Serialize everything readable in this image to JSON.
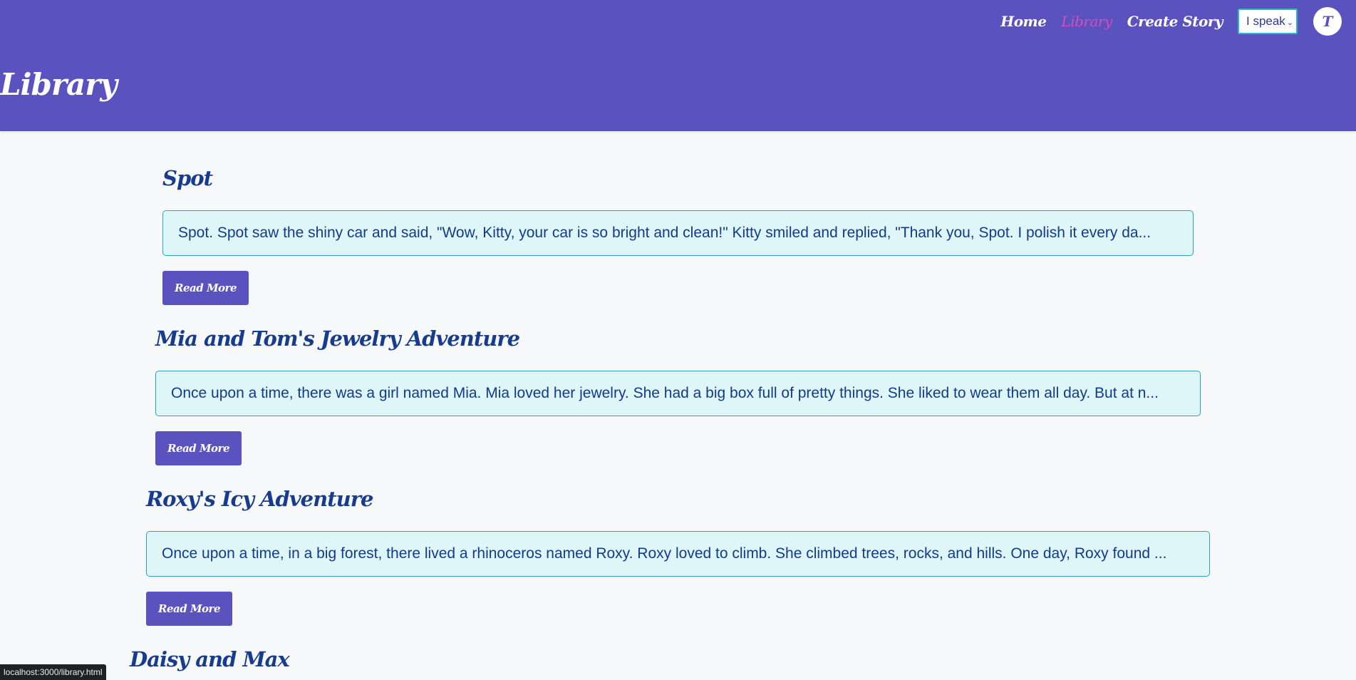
{
  "header": {
    "title": "Library",
    "nav": [
      {
        "label": "Home",
        "active": false
      },
      {
        "label": "Library",
        "active": true
      },
      {
        "label": "Create Story",
        "active": false
      }
    ],
    "language_select": {
      "value": "I speak",
      "icon": "chevron-down-icon"
    },
    "avatar_initial": "T"
  },
  "stories": [
    {
      "title": "Spot",
      "excerpt": "Spot. Spot saw the shiny car and said, \"Wow, Kitty, your car is so bright and clean!\" Kitty smiled and replied, \"Thank you, Spot. I polish it every da...",
      "button": "Read More"
    },
    {
      "title": "Mia and Tom's Jewelry Adventure",
      "excerpt": "Once upon a time, there was a girl named Mia. Mia loved her jewelry. She had a big box full of pretty things. She liked to wear them all day. But at n...",
      "button": "Read More"
    },
    {
      "title": "Roxy's Icy Adventure",
      "excerpt": "Once upon a time, in a big forest, there lived a rhinoceros named Roxy. Roxy loved to climb. She climbed trees, rocks, and hills. One day, Roxy found ...",
      "button": "Read More"
    },
    {
      "title": "Daisy and Max"
    }
  ],
  "status_bar": {
    "url": "localhost:3000/library.html"
  },
  "colors": {
    "header_bg": "#5a52be",
    "active_link": "#d94cbc",
    "title_text": "#173c8e",
    "excerpt_bg": "#dff6f8",
    "excerpt_border": "#2ba4b4"
  }
}
